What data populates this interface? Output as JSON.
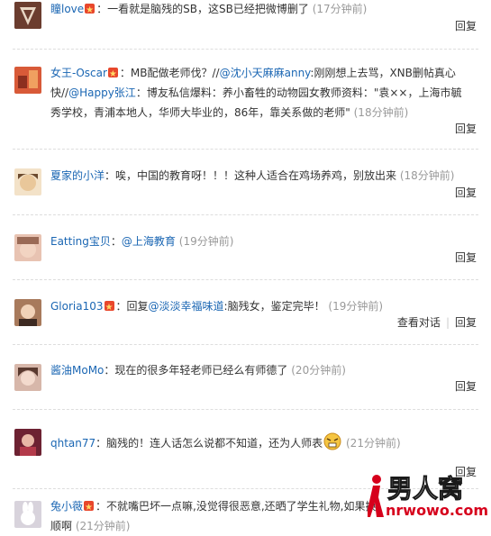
{
  "reply_label": "回复",
  "view_conversation_label": "查看对话",
  "comments": [
    {
      "name": "瞳love",
      "vip": true,
      "segments": [
        {
          "t": "：一看就是脑残的SB，这SB已经把微博删了"
        }
      ],
      "time": "(17分钟前)",
      "avatar_color": "#7a4a3a"
    },
    {
      "name": "女王-Oscar",
      "vip": true,
      "segments": [
        {
          "t": "：MB配做老师伐？//"
        },
        {
          "t": "@沈小天麻麻anny",
          "link": true
        },
        {
          "t": ":刚刚想上去骂，XNB删帖真心快//"
        },
        {
          "t": "@Happy张江",
          "link": true
        },
        {
          "t": "：博友私信爆料：养小畜牲的动物园女教师资料：\"袁××，上海市毓秀学校，青浦本地人，华师大毕业的，86年，靠关系做的老师\""
        }
      ],
      "time": "(18分钟前)",
      "avatar_color": "#c8502e"
    },
    {
      "name": "夏家的小洋",
      "vip": false,
      "segments": [
        {
          "t": "：唉，中国的教育呀！！！这种人适合在鸡场养鸡，别放出来"
        }
      ],
      "time": "(18分钟前)",
      "avatar_color": "#e9c79a"
    },
    {
      "name": "Eatting宝贝",
      "vip": false,
      "segments": [
        {
          "t": "："
        },
        {
          "t": "@上海教育",
          "link": true
        }
      ],
      "time": "(19分钟前)",
      "avatar_color": "#d9a38c"
    },
    {
      "name": "Gloria103",
      "vip": true,
      "segments": [
        {
          "t": "：回复"
        },
        {
          "t": "@淡淡幸福味道",
          "link": true
        },
        {
          "t": ":脑残女，鉴定完毕！"
        }
      ],
      "time": "(19分钟前)",
      "avatar_color": "#8b5a3c"
    },
    {
      "name": "酱油MoMo",
      "vip": false,
      "segments": [
        {
          "t": "：现在的很多年轻老师已经么有师德了"
        }
      ],
      "time": "(20分钟前)",
      "avatar_color": "#b88a78"
    },
    {
      "name": "qhtan77",
      "vip": false,
      "segments": [
        {
          "t": "：脑残的！连人话怎么说都不知道，还为人师表"
        }
      ],
      "time": "(21分钟前)",
      "avatar_color": "#7d2a3a"
    },
    {
      "name": "兔小薇",
      "vip": true,
      "segments": [
        {
          "t": "：不就嘴巴坏一点嘛,没觉得很恶意,还晒了学生礼物,如果换"
        },
        {
          "t": "顺啊"
        }
      ],
      "time": "(21分钟前)",
      "avatar_color": "#c9c4cf"
    }
  ],
  "watermark": {
    "cn": "男人窝",
    "url": "nrwowo.com"
  },
  "colors": {
    "link": "#1a66b3",
    "time": "#999999",
    "text": "#333333",
    "vip": "#e8472c"
  }
}
